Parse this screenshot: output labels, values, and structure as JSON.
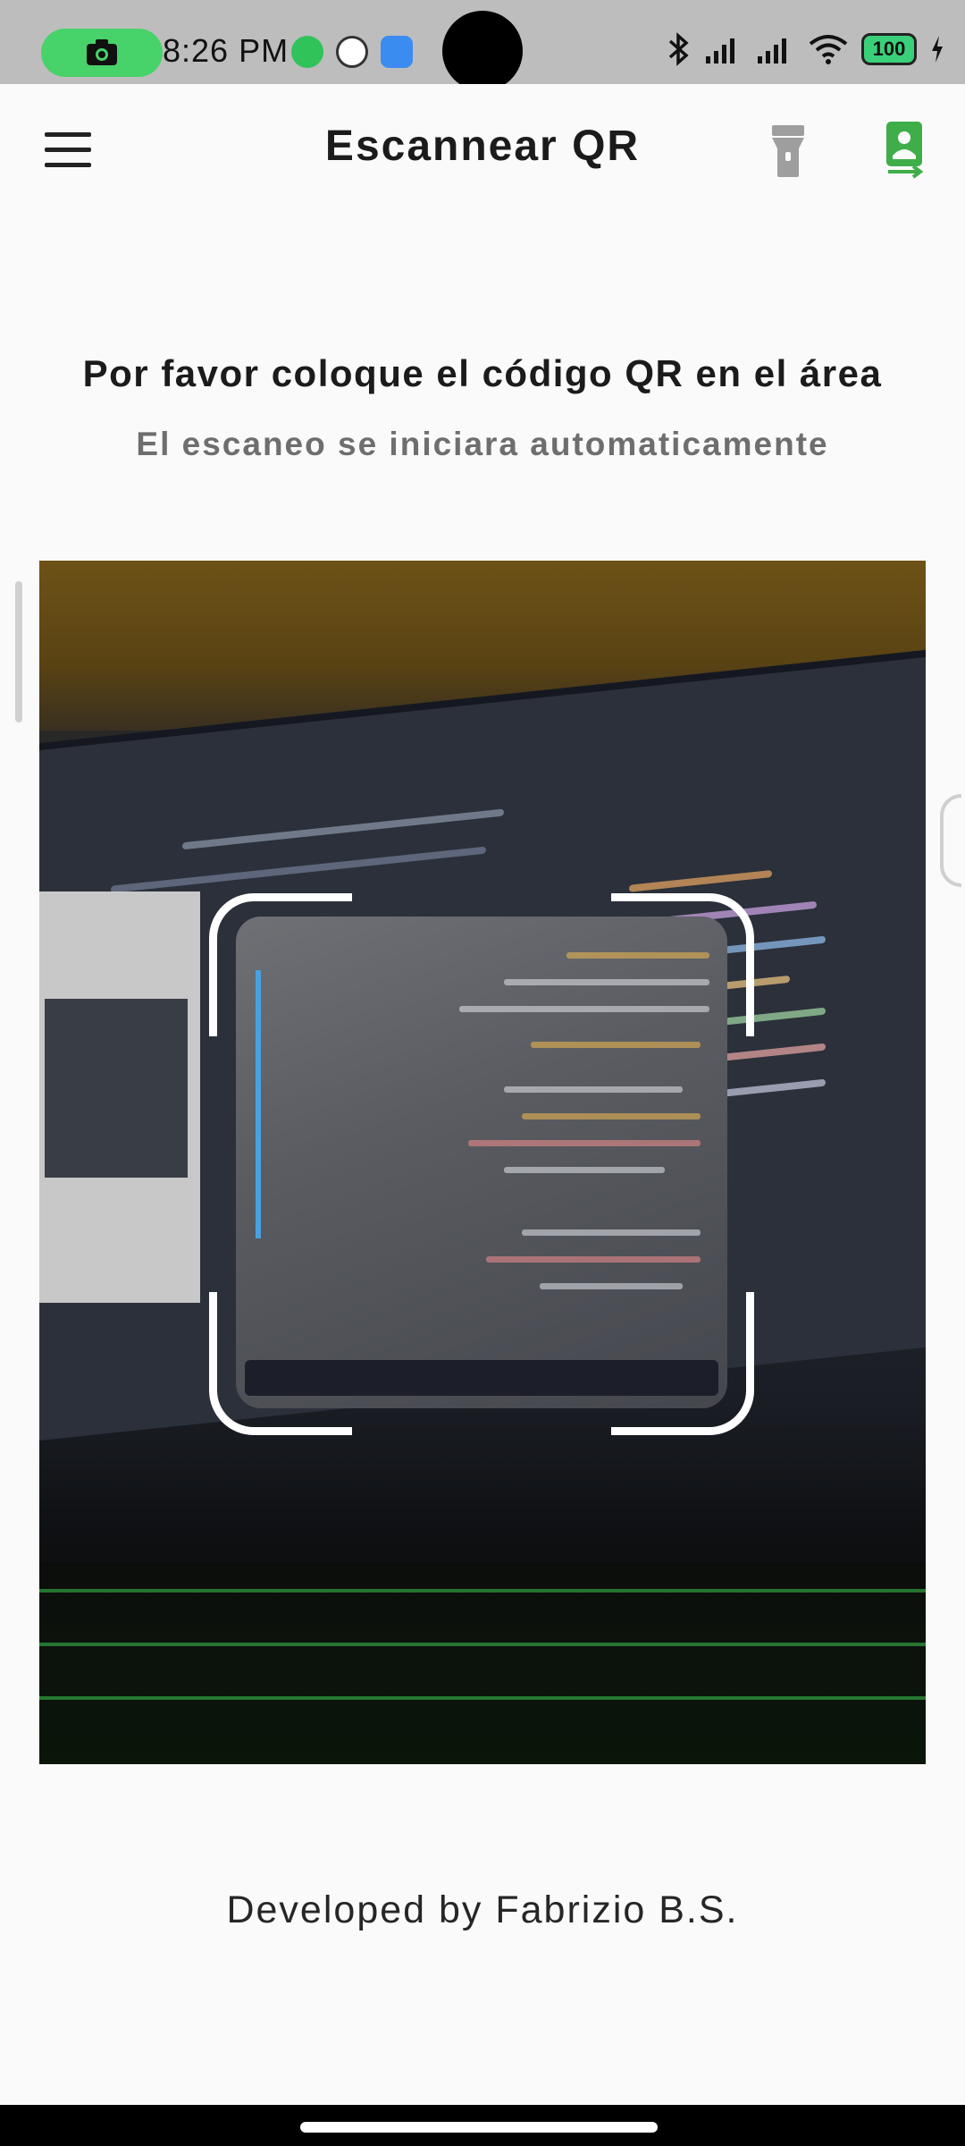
{
  "status_bar": {
    "time": "8:26 PM",
    "battery": "100",
    "icons": [
      "camera-recording-icon",
      "whatsapp-icon",
      "compass-app-icon",
      "play-store-icon",
      "bluetooth-icon",
      "signal-icon",
      "signal-icon",
      "wifi-icon",
      "battery-icon",
      "charging-icon"
    ]
  },
  "app_bar": {
    "title": "Escannear QR",
    "menu_icon": "hamburger-menu-icon",
    "flash_icon": "flashlight-icon",
    "switch_camera_icon": "switch-camera-icon",
    "accent_color": "#3fae49"
  },
  "instructions": {
    "title": "Por favor coloque el código QR en el área",
    "subtitle": "El escaneo se iniciara automaticamente"
  },
  "footer": {
    "credit": "Developed by Fabrizio B.S."
  }
}
